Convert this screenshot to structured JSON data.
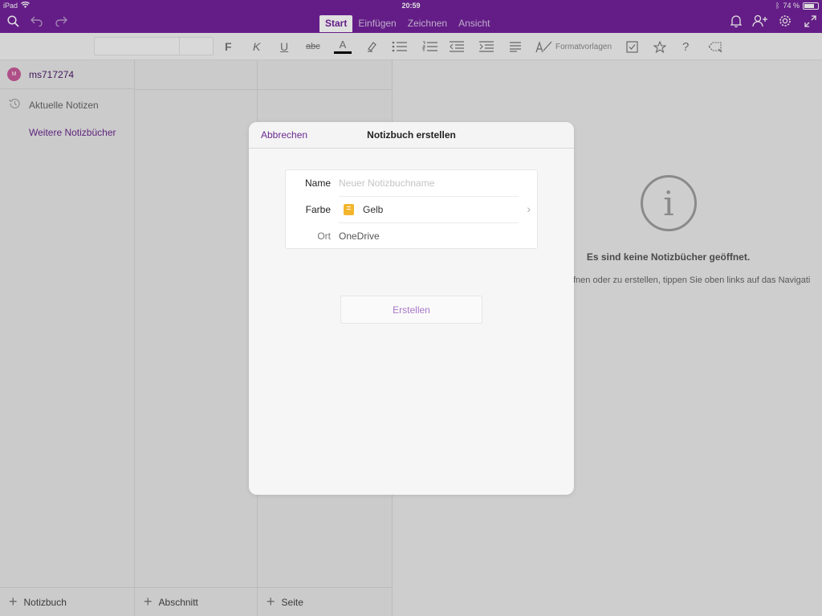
{
  "status": {
    "device": "iPad",
    "time": "20:59",
    "battery": "74 %",
    "battery_level": 0.74
  },
  "toolbar": {
    "tabs": [
      {
        "label": "Start",
        "active": true
      },
      {
        "label": "Einfügen",
        "active": false
      },
      {
        "label": "Zeichnen",
        "active": false
      },
      {
        "label": "Ansicht",
        "active": false
      }
    ],
    "bold": "F",
    "italic": "K",
    "underline": "U",
    "strike": "abc",
    "font_color": "A",
    "styles_label": "Formatvorlagen"
  },
  "sidebar": {
    "account_initial": "M",
    "account_name": "ms717274",
    "recent_label": "Aktuelle Notizen",
    "more_label": "Weitere Notizbücher"
  },
  "bottom": {
    "notebook": "Notizbuch",
    "section": "Abschnitt",
    "page": "Seite"
  },
  "main": {
    "info_symbol": "i",
    "empty_title": "Es sind keine Notizbücher geöffnet.",
    "empty_text": "fnen oder zu erstellen, tippen Sie oben links auf das Navigati"
  },
  "dialog": {
    "cancel": "Abbrechen",
    "title": "Notizbuch erstellen",
    "name_label": "Name",
    "name_placeholder": "Neuer Notizbuchname",
    "color_label": "Farbe",
    "color_value": "Gelb",
    "location_label": "Ort",
    "location_value": "OneDrive",
    "create_button": "Erstellen"
  },
  "colors": {
    "brand": "#72219a",
    "notebook_yellow": "#f2b52d"
  }
}
